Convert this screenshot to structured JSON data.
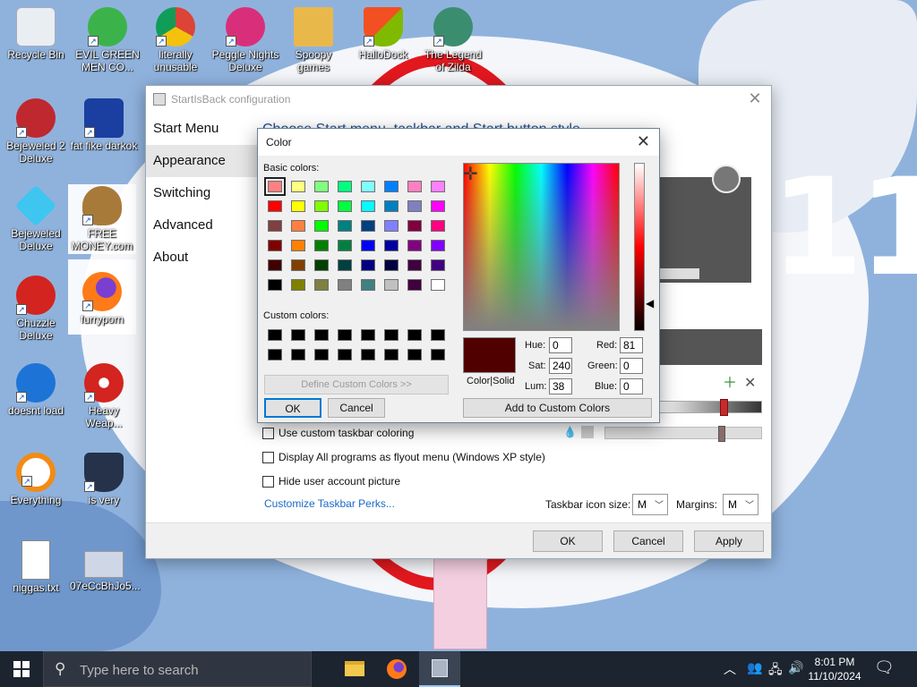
{
  "desktop": {
    "icons": [
      {
        "label": "Recycle Bin"
      },
      {
        "label": "EVIL GREEN MEN CO..."
      },
      {
        "label": "literally unusable"
      },
      {
        "label": "Peggle Nights Deluxe"
      },
      {
        "label": "Spoopy games"
      },
      {
        "label": "HalloDock"
      },
      {
        "label": "The Legend of Zilda"
      },
      {
        "label": "Bejeweled 2 Deluxe"
      },
      {
        "label": "fat fike darkok"
      },
      {
        "label": "Bejeweled Deluxe"
      },
      {
        "label": "FREE MONEY.com"
      },
      {
        "label": "Chuzzle Deluxe"
      },
      {
        "label": "furryporn"
      },
      {
        "label": "doesnt load"
      },
      {
        "label": "Heavy Weap..."
      },
      {
        "label": "Everything"
      },
      {
        "label": "is very"
      },
      {
        "label": "niggas.txt"
      },
      {
        "label": "07eCcBhJo5..."
      }
    ],
    "wallpaper_text": "11",
    "colors": {
      "wallpaper_blue": "#8fb2dd",
      "ring_red": "#e2181e"
    }
  },
  "sib_window": {
    "title": "StartIsBack configuration",
    "nav": [
      "Start Menu",
      "Appearance",
      "Switching",
      "Advanced",
      "About"
    ],
    "active_nav": "Appearance",
    "heading": "Choose Start menu, taskbar and Start button style",
    "options": [
      {
        "label": "Use custom taskbar coloring",
        "checked": false
      },
      {
        "label": "Display All programs as flyout menu (Windows XP style)",
        "checked": false
      },
      {
        "label": "Hide user account picture",
        "checked": false
      }
    ],
    "link": "Customize Taskbar Perks...",
    "icon_size_label": "Taskbar icon size:",
    "icon_size_value": "M",
    "margins_label": "Margins:",
    "margins_value": "M",
    "buttons": {
      "ok": "OK",
      "cancel": "Cancel",
      "apply": "Apply"
    }
  },
  "color_dialog": {
    "title": "Color",
    "basic_colors_label": "Basic colors:",
    "basic_colors": [
      [
        "#ff8080",
        "#ffff80",
        "#80ff80",
        "#00ff80",
        "#80ffff",
        "#0080ff",
        "#ff80c0",
        "#ff80ff"
      ],
      [
        "#ff0000",
        "#ffff00",
        "#80ff00",
        "#00ff40",
        "#00ffff",
        "#0080c0",
        "#8080c0",
        "#ff00ff"
      ],
      [
        "#804040",
        "#ff8040",
        "#00ff00",
        "#008080",
        "#004080",
        "#8080ff",
        "#800040",
        "#ff0080"
      ],
      [
        "#800000",
        "#ff8000",
        "#008000",
        "#008040",
        "#0000ff",
        "#0000a0",
        "#800080",
        "#8000ff"
      ],
      [
        "#400000",
        "#804000",
        "#004000",
        "#004040",
        "#000080",
        "#000040",
        "#400040",
        "#400080"
      ],
      [
        "#000000",
        "#808000",
        "#808040",
        "#808080",
        "#408080",
        "#c0c0c0",
        "#400040",
        "#ffffff"
      ]
    ],
    "custom_colors_label": "Custom colors:",
    "custom_colors": [
      [
        "#000000",
        "#000000",
        "#000000",
        "#000000",
        "#000000",
        "#000000",
        "#000000",
        "#000000"
      ],
      [
        "#000000",
        "#000000",
        "#000000",
        "#000000",
        "#000000",
        "#000000",
        "#000000",
        "#000000"
      ]
    ],
    "define_custom_label": "Define Custom Colors >>",
    "ok_label": "OK",
    "cancel_label": "Cancel",
    "color_solid_label": "Color|Solid",
    "hue_label": "Hue:",
    "hue": "0",
    "sat_label": "Sat:",
    "sat": "240",
    "lum_label": "Lum:",
    "lum": "38",
    "red_label": "Red:",
    "red": "81",
    "green_label": "Green:",
    "green": "0",
    "blue_label": "Blue:",
    "blue": "0",
    "add_custom_label": "Add to Custom Colors",
    "current_color": "#510000"
  },
  "taskbar": {
    "search_placeholder": "Type here to search",
    "time": "8:01 PM",
    "date": "11/10/2024"
  }
}
